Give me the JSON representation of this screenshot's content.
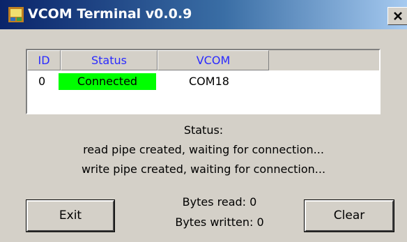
{
  "window": {
    "title": "VCOM Terminal v0.0.9",
    "close_symbol": "X"
  },
  "listview": {
    "columns": [
      "ID",
      "Status",
      "VCOM"
    ],
    "rows": [
      {
        "id": "0",
        "status": "Connected",
        "vcom": "COM18"
      }
    ],
    "status_color": "#00ff00"
  },
  "status": {
    "heading": "Status:",
    "lines": [
      "read pipe created, waiting for connection...",
      "write pipe created, waiting for connection..."
    ]
  },
  "counters": {
    "bytes_read": "Bytes read: 0",
    "bytes_written": "Bytes written: 0"
  },
  "buttons": {
    "exit": "Exit",
    "clear": "Clear"
  },
  "colors": {
    "title_start": "#0a246a",
    "title_end": "#a6caf0",
    "face": "#d4d0c8",
    "header_text": "#2a2aff"
  }
}
